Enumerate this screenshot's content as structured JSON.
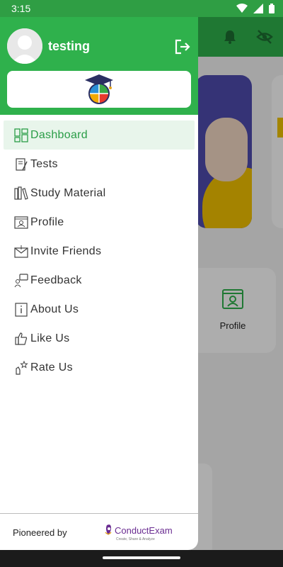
{
  "status_bar": {
    "time": "3:15"
  },
  "header": {
    "username": "testing"
  },
  "menu": [
    {
      "label": "Dashboard",
      "icon": "dashboard-icon",
      "active": true
    },
    {
      "label": "Tests",
      "icon": "tests-icon"
    },
    {
      "label": "Study Material",
      "icon": "books-icon"
    },
    {
      "label": "Profile",
      "icon": "profile-icon"
    },
    {
      "label": "Invite Friends",
      "icon": "invite-icon"
    },
    {
      "label": "Feedback",
      "icon": "feedback-icon"
    },
    {
      "label": "About Us",
      "icon": "info-icon"
    },
    {
      "label": "Like Us",
      "icon": "like-icon"
    },
    {
      "label": "Rate Us",
      "icon": "rate-icon"
    }
  ],
  "footer": {
    "label": "Pioneered by",
    "brand": "ConductExam",
    "tagline": "Create, Share & Analyze"
  },
  "background": {
    "card_label": "Profile"
  },
  "colors": {
    "primary": "#2fb14c",
    "active_bg": "#e8f5eb",
    "active_text": "#2a9d47",
    "brand_purple": "#6a2c91"
  }
}
